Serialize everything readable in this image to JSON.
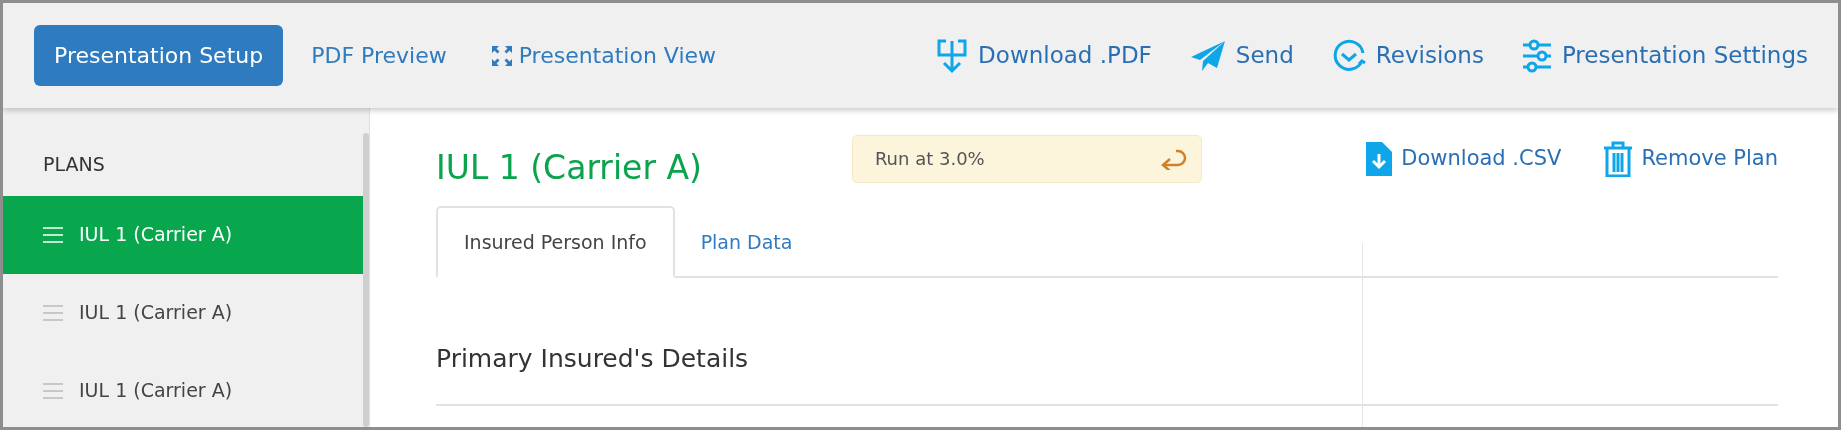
{
  "top_nav": {
    "tabs": [
      {
        "label": "Presentation Setup",
        "selected": true
      },
      {
        "label": "PDF Preview",
        "selected": false
      },
      {
        "label": "Presentation View",
        "selected": false
      }
    ],
    "actions": [
      {
        "label": "Download .PDF"
      },
      {
        "label": "Send"
      },
      {
        "label": "Revisions"
      },
      {
        "label": "Presentation Settings"
      }
    ]
  },
  "sidebar": {
    "heading": "PLANS",
    "items": [
      {
        "label": "IUL 1 (Carrier A)",
        "selected": true
      },
      {
        "label": "IUL 1 (Carrier A)",
        "selected": false
      },
      {
        "label": "IUL 1 (Carrier A)",
        "selected": false
      }
    ]
  },
  "plan": {
    "title": "IUL 1 (Carrier A)",
    "run_badge": "Run at 3.0%",
    "actions": [
      {
        "label": "Download .CSV"
      },
      {
        "label": "Remove Plan"
      }
    ],
    "tabs": [
      {
        "label": "Insured Person Info",
        "selected": true
      },
      {
        "label": "Plan Data",
        "selected": false
      }
    ],
    "section_heading": "Primary Insured's Details"
  }
}
